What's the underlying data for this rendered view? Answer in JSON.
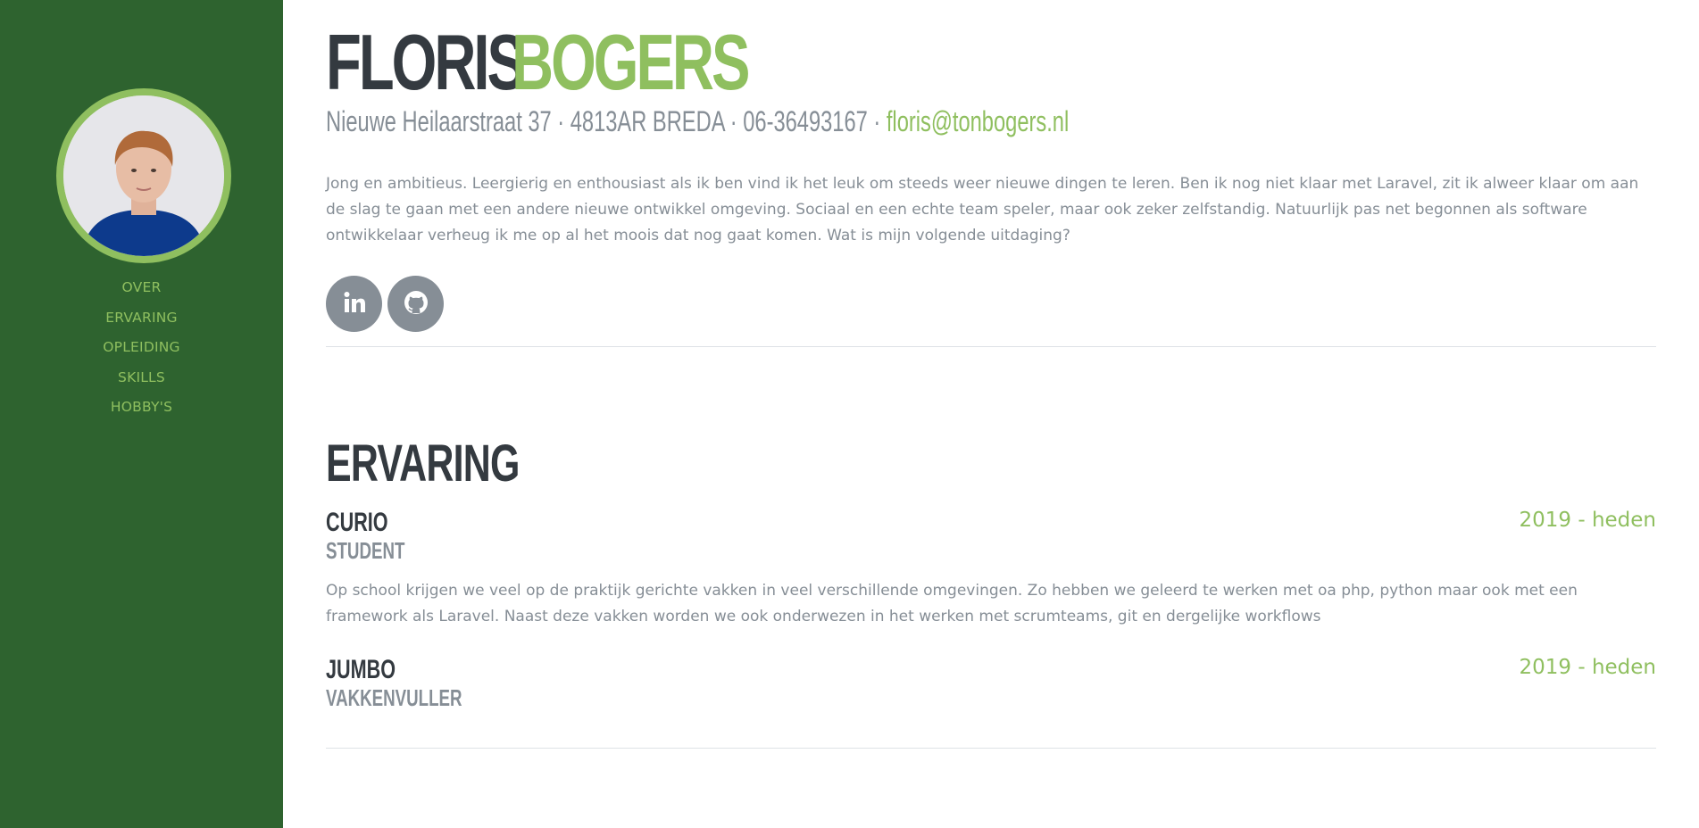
{
  "profile": {
    "first_name": "FLORIS",
    "last_name": "BOGERS",
    "address": "Nieuwe Heilaarstraat 37 · 4813AR BREDA · 06-36493167 ·",
    "email": "floris@tonbogers.nl",
    "intro": "Jong en ambitieus. Leergierig en enthousiast als ik ben vind ik het leuk om steeds weer nieuwe dingen te leren. Ben ik nog niet klaar met Laravel, zit ik alweer klaar om aan de slag te gaan met een andere nieuwe ontwikkel omgeving. Sociaal en een echte team speler, maar ook zeker zelfstandig. Natuurlijk pas net begonnen als software ontwikkelaar verheug ik me op al het moois dat nog gaat komen. Wat is mijn volgende uitdaging?"
  },
  "nav": {
    "items": [
      {
        "label": "OVER"
      },
      {
        "label": "ERVARING"
      },
      {
        "label": "OPLEIDING"
      },
      {
        "label": "SKILLS"
      },
      {
        "label": "HOBBY'S"
      }
    ]
  },
  "social": {
    "items": [
      {
        "icon": "linkedin-icon"
      },
      {
        "icon": "github-icon"
      }
    ]
  },
  "experience": {
    "title": "ERVARING",
    "jobs": [
      {
        "company": "CURIO",
        "role": "STUDENT",
        "period": "2019 - heden",
        "description": "Op school krijgen we veel op de praktijk gerichte vakken in veel verschillende omgevingen. Zo hebben we geleerd te werken met oa php, python maar ook met een framework als Laravel. Naast deze vakken worden we ook onderwezen in het werken met scrumteams, git en dergelijke workflows"
      },
      {
        "company": "JUMBO",
        "role": "VAKKENVULLER",
        "period": "2019 - heden"
      }
    ]
  },
  "colors": {
    "sidebar": "#2e632f",
    "accent": "#8fbf5f",
    "heading": "#343a40",
    "muted": "#868e96"
  }
}
